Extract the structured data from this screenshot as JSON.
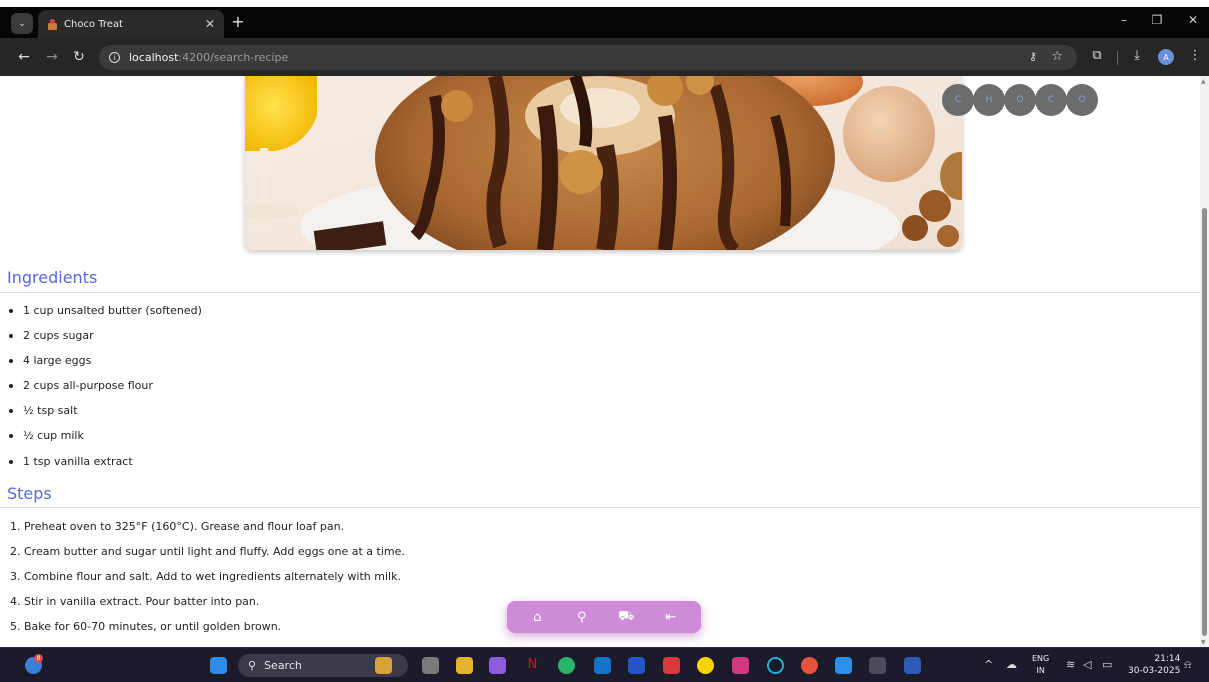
{
  "browser": {
    "tab_title": "Choco Treat",
    "url_host": "localhost",
    "url_path": ":4200/search-recipe",
    "profile_initial": "A"
  },
  "hero_image": {
    "description_icon": "chocolate-walnut-bundt-cake-image"
  },
  "float_nav": [
    "C",
    "H",
    "O",
    "C",
    "O"
  ],
  "ingredients": {
    "heading": "Ingredients",
    "items": [
      "1 cup unsalted butter (softened)",
      "2 cups sugar",
      "4 large eggs",
      "2 cups all-purpose flour",
      "½ tsp salt",
      "½ cup milk",
      "1 tsp vanilla extract"
    ]
  },
  "steps": {
    "heading": "Steps",
    "items": [
      "1. Preheat oven to 325°F (160°C). Grease and flour loaf pan.",
      "2. Cream butter and sugar until light and fluffy. Add eggs one at a time.",
      "3. Combine flour and salt. Add to wet ingredients alternately with milk.",
      "4. Stir in vanilla extract. Pour batter into pan.",
      "5. Bake for 60-70 minutes, or until golden brown."
    ]
  },
  "bottom_nav": {
    "icons": [
      "home-icon",
      "search-icon",
      "cart-icon",
      "logout-icon"
    ],
    "color": "#cf8ad9"
  },
  "taskbar": {
    "search_placeholder": "Search",
    "weather_badge": "8",
    "lang_line1": "ENG",
    "lang_line2": "IN",
    "time": "21:14",
    "date": "30-03-2025"
  },
  "colors": {
    "heading": "#5a67d8",
    "tab_bar": "#060606",
    "nav_bar": "#262626"
  }
}
